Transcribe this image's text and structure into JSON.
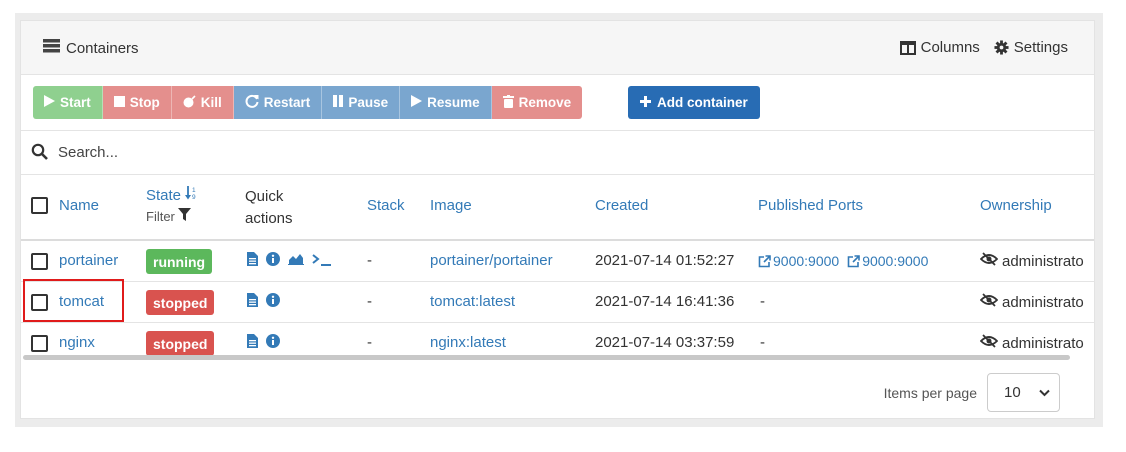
{
  "header": {
    "title": "Containers",
    "columns_label": "Columns",
    "settings_label": "Settings"
  },
  "toolbar": {
    "start": "Start",
    "stop": "Stop",
    "kill": "Kill",
    "restart": "Restart",
    "pause": "Pause",
    "resume": "Resume",
    "remove": "Remove",
    "add": "Add container"
  },
  "search": {
    "placeholder": "Search..."
  },
  "columns": {
    "name": "Name",
    "state": "State",
    "filter": "Filter",
    "quick_actions": "Quick actions",
    "stack": "Stack",
    "image": "Image",
    "created": "Created",
    "ports": "Published Ports",
    "ownership": "Ownership"
  },
  "rows": [
    {
      "name": "portainer",
      "state": "running",
      "quick_actions": [
        "logs-icon",
        "inspect-icon",
        "stats-icon",
        "console-icon"
      ],
      "stack": "-",
      "image": "portainer/portainer",
      "created": "2021-07-14 01:52:27",
      "ports": [
        "9000:9000",
        "9000:9000"
      ],
      "ownership": "administrato"
    },
    {
      "name": "tomcat",
      "state": "stopped",
      "quick_actions": [
        "logs-icon",
        "inspect-icon"
      ],
      "stack": "-",
      "image": "tomcat:latest",
      "created": "2021-07-14 16:41:36",
      "ports_text": "-",
      "ownership": "administrato"
    },
    {
      "name": "nginx",
      "state": "stopped",
      "quick_actions": [
        "logs-icon",
        "inspect-icon"
      ],
      "stack": "-",
      "image": "nginx:latest",
      "created": "2021-07-14 03:37:59",
      "ports_text": "-",
      "ownership": "administrato"
    }
  ],
  "pagination": {
    "items_per_page_label": "Items per page",
    "items_per_page": "10"
  },
  "colors": {
    "link": "#337ab7",
    "running": "#5cb85c",
    "stopped": "#d9534f",
    "primary": "#286cb4",
    "highlight": "#e01b1b"
  }
}
